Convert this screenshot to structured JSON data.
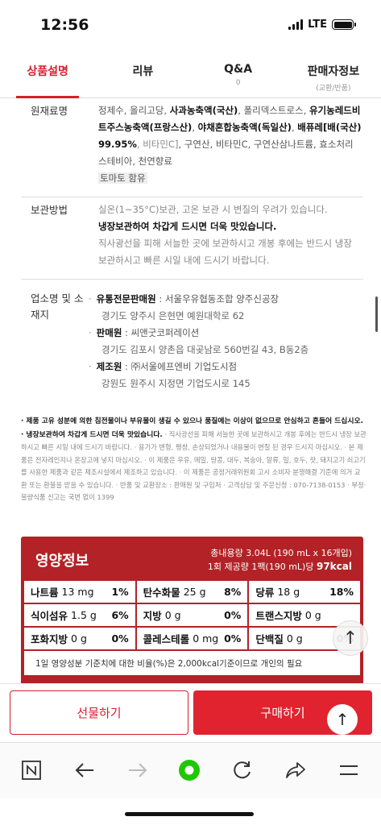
{
  "status": {
    "time": "12:56",
    "network": "LTE"
  },
  "tabs": [
    {
      "label": "상품설명",
      "sub": ""
    },
    {
      "label": "리뷰",
      "sub": ""
    },
    {
      "label": "Q&A",
      "sub": "0"
    },
    {
      "label": "판매자정보",
      "sub": "(교환/반품)"
    }
  ],
  "ingredients": {
    "key": "원재료명",
    "parts": [
      {
        "t": "정제수, 올리고당, ",
        "s": "n"
      },
      {
        "t": "사과농축액(국산)",
        "s": "b"
      },
      {
        "t": ", 폴리덱스트로스, ",
        "s": "n"
      },
      {
        "t": "유기농레드비트주스농축액(프랑스산)",
        "s": "b"
      },
      {
        "t": ", ",
        "s": "n"
      },
      {
        "t": "야채혼합농축액(독일산)",
        "s": "b"
      },
      {
        "t": ", ",
        "s": "n"
      },
      {
        "t": "배퓨레[배(국산) 99.95%",
        "s": "b"
      },
      {
        "t": ", 비타민C]",
        "s": "l"
      },
      {
        "t": ", 구연산, 비타민C, 구연산삼나트륨, 효소처리스테비아, 천연향료",
        "s": "n"
      },
      {
        "t": "토마토 함유",
        "s": "h"
      }
    ]
  },
  "storage": {
    "key": "보관방법",
    "line1": "실온(1~35°C)보관, 고온 보관 시 변질의 우려가 있습니다.",
    "line2": "냉장보관하여 차갑게 드시면 더욱 맛있습니다.",
    "line3": "직사광선을 피해 서늘한 곳에 보관하시고 개봉 후에는 반드시 냉장 보관하시고 빠른 시일 내에 드시기 바랍니다."
  },
  "business": {
    "key": "업소명 및 소재지",
    "entries": [
      {
        "role": "유통전문판매원",
        "name": " : 서울우유협동조합 양주신공장",
        "addr": "경기도 양주시 은현면 예원대학로 62"
      },
      {
        "role": "판매원",
        "name": " : 씨앤굿코퍼레이션",
        "addr": "경기도 김포시 양촌읍 대곶남로 560번길 43, B동2층"
      },
      {
        "role": "제조원",
        "name": " : ㈜서울에프엔비 기업도시점",
        "addr": "강원도 원주시 지정면 기업도시로 145"
      }
    ]
  },
  "notice": {
    "bold1": "· 제품 고유 성분에 의한 침전물이나 부유물이 생길 수 있으나 품질에는 이상이 없으므로 안심하고 흔들어 드십시오.",
    "bold2": "· 냉장보관하여 차갑게 드시면 더욱 맛있습니다.",
    "rest": "· 직사광선을 피해 서늘한 곳에 보관하시고 개봉 후에는 반드시 냉장 보관하시고 빠른 시일 내에 드시기 바랍니다. · 용기가 변형, 팽창, 손상되었거나 내용물이 변질 된 경우 드시지 마십시오. · 본 제품은 전자레인지나 온장고에 넣지 마십시오. · 이 제품은 우유, 메밀, 땅콩, 대두, 복숭아, 알류, 밀, 호두, 잣, 돼지고기 쇠고기를 사용한 제품과 같은 제조시설에서 제조하고 있습니다. · 이 제품은 공정거래위원회 고시 소비자 분쟁해결 기준에 의거 교환 또는 환불을 받을 수 있습니다. · 반품 및 교환장소 : 판매원 및 구입처 · 고객상담 및 주문신청 : 070-7138-0153 · 부정·불량식품 신고는 국번 없이 1399"
  },
  "nutrition": {
    "title": "영양정보",
    "total_line": "총내용량 3.04L (190 mL x 16개입)",
    "serving_prefix": "1회 제공량 1팩(190 mL)당 ",
    "kcal": "97kcal",
    "rows": [
      [
        {
          "name": "나트륨",
          "amount": "13 mg",
          "pct": "1%"
        },
        {
          "name": "탄수화물",
          "amount": "25 g",
          "pct": "8%"
        },
        {
          "name": "당류",
          "amount": "18 g",
          "pct": "18%"
        }
      ],
      [
        {
          "name": "식이섬유",
          "amount": "1.5 g",
          "pct": "6%"
        },
        {
          "name": "지방",
          "amount": "0 g",
          "pct": "0%"
        },
        {
          "name": "트랜스지방",
          "amount": "0 g",
          "pct": ""
        }
      ],
      [
        {
          "name": "포화지방",
          "amount": "0 g",
          "pct": "0%"
        },
        {
          "name": "콜레스테롤",
          "amount": "0 mg",
          "pct": "0%"
        },
        {
          "name": "단백질",
          "amount": "0 g",
          "pct": "0%"
        }
      ]
    ],
    "footnote": "1일 영양성분 기준치에 대한 비율(%)은 2,000kcal기준이므로 개인의 필요"
  },
  "actions": {
    "gift": "선물하기",
    "buy": "구매하기"
  },
  "colors": {
    "accent": "#d61f2c",
    "nutrition_bg": "#b32226",
    "toolbar_green": "#1ec800"
  },
  "icons": [
    "naver-n-icon",
    "back-arrow-icon",
    "forward-arrow-icon",
    "green-dot-icon",
    "reload-icon",
    "share-icon",
    "menu-icon",
    "scroll-up-icon"
  ]
}
